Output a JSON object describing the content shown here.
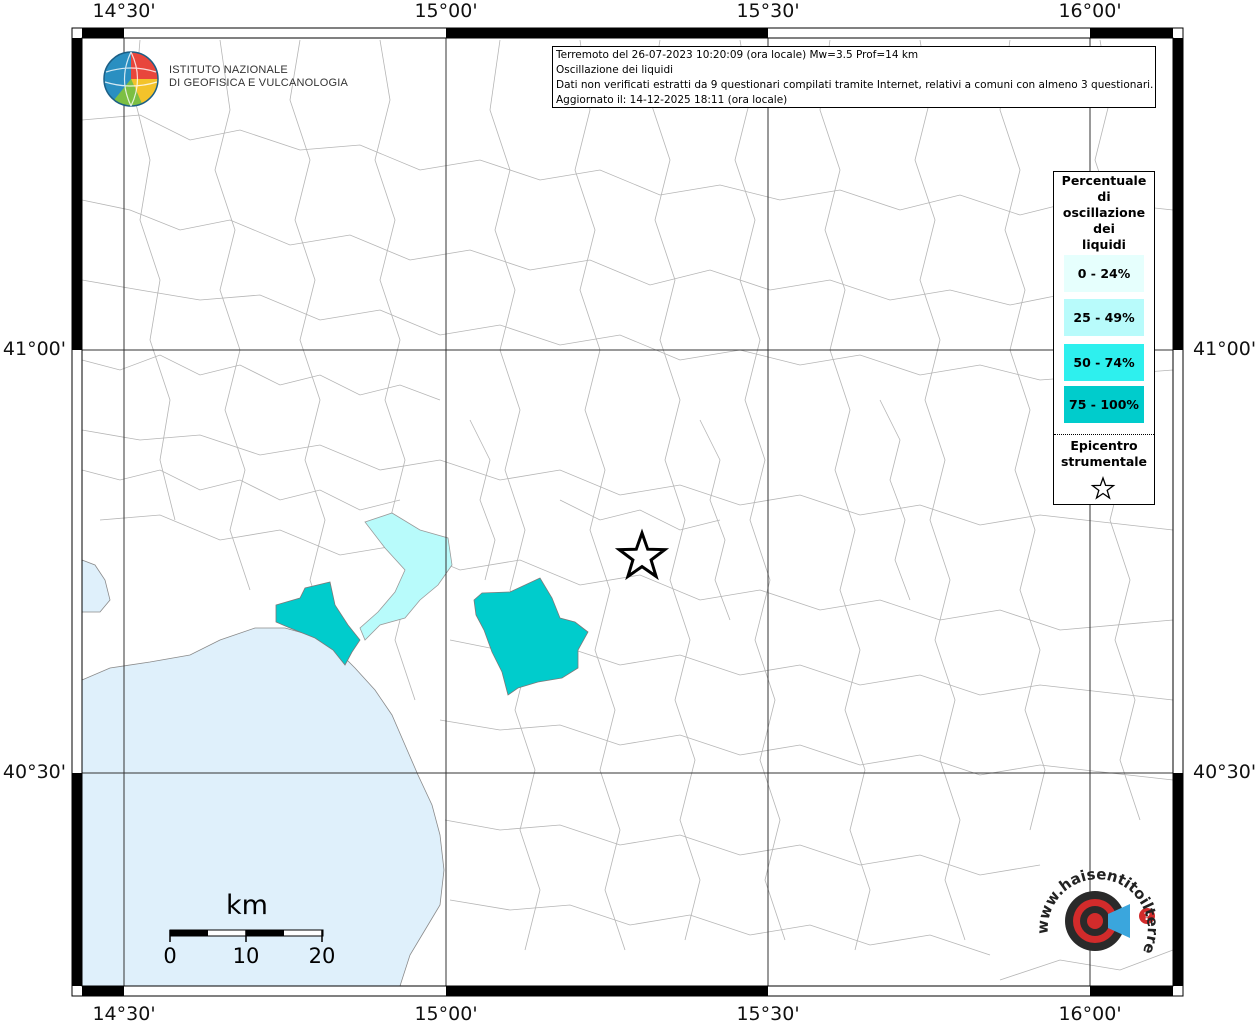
{
  "map": {
    "title": "Terremoto del 26-07-2023 10:20:09 (ora locale) Mw=3.5 Prof=14 km",
    "subtitle": "Oscillazione dei liquidi",
    "note": "Dati non verificati estratti da 9 questionari compilati tramite Internet, relativi a comuni con almeno 3 questionari.",
    "updated": "Aggiornato il: 14-12-2025 18:11 (ora locale)"
  },
  "axes": {
    "longitudes": [
      "14°30'",
      "15°00'",
      "15°30'",
      "16°00'"
    ],
    "latitudes": [
      "41°00'",
      "40°30'"
    ]
  },
  "legend": {
    "title_lines": [
      "Percentuale",
      "di",
      "oscillazione",
      "dei",
      "liquidi"
    ],
    "items": [
      {
        "label": "0 - 24%",
        "color": "#e6fffd"
      },
      {
        "label": "25 - 49%",
        "color": "#b8fbfb"
      },
      {
        "label": "50 - 74%",
        "color": "#2ef0ee"
      },
      {
        "label": "75 - 100%",
        "color": "#00cccc"
      }
    ],
    "epicenter_lines": [
      "Epicentro",
      "strumentale"
    ]
  },
  "scale": {
    "unit": "km",
    "labels": [
      "0",
      "10",
      "20"
    ]
  },
  "logos": {
    "ingv_line1": "ISTITUTO NAZIONALE",
    "ingv_line2": "DI GEOFISICA E VULCANOLOGIA",
    "hsit": "www.haisentitoilterremoto.it"
  },
  "colors": {
    "sea": "#dff0fb",
    "land": "#ffffff",
    "borders": "#b0b0b0"
  }
}
